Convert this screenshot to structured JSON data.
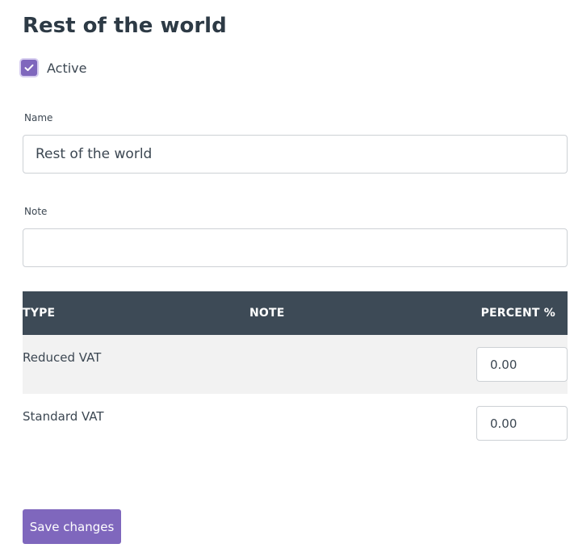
{
  "page": {
    "title": "Rest of the world"
  },
  "active": {
    "label": "Active",
    "checked": true
  },
  "form": {
    "name_label": "Name",
    "name_value": "Rest of the world",
    "note_label": "Note",
    "note_value": ""
  },
  "table": {
    "headers": {
      "type": "TYPE",
      "note": "NOTE",
      "percent": "PERCENT %"
    },
    "rows": [
      {
        "type": "Reduced VAT",
        "note": "",
        "percent": "0.00"
      },
      {
        "type": "Standard VAT",
        "note": "",
        "percent": "0.00"
      }
    ]
  },
  "actions": {
    "save_label": "Save changes"
  },
  "colors": {
    "accent": "#7f67bd",
    "table_header": "#3d4a56",
    "row_stripe": "#f2f2f2"
  }
}
